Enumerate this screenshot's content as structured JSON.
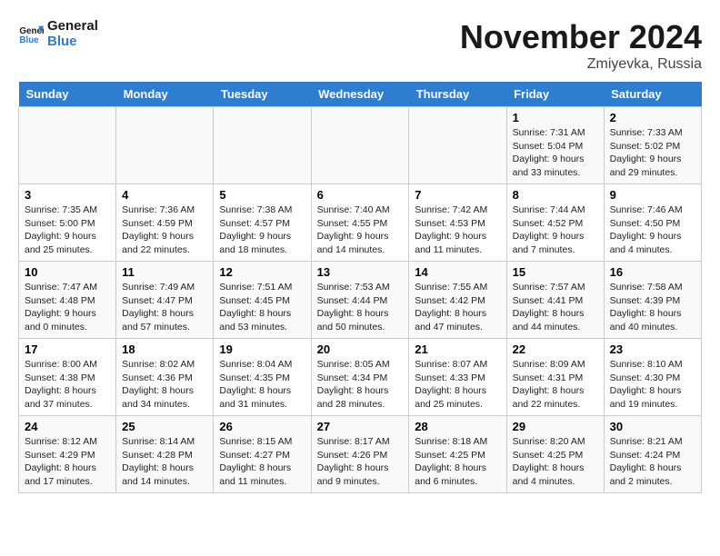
{
  "header": {
    "logo_line1": "General",
    "logo_line2": "Blue",
    "month": "November 2024",
    "location": "Zmiyevka, Russia"
  },
  "weekdays": [
    "Sunday",
    "Monday",
    "Tuesday",
    "Wednesday",
    "Thursday",
    "Friday",
    "Saturday"
  ],
  "weeks": [
    [
      {
        "day": "",
        "info": ""
      },
      {
        "day": "",
        "info": ""
      },
      {
        "day": "",
        "info": ""
      },
      {
        "day": "",
        "info": ""
      },
      {
        "day": "",
        "info": ""
      },
      {
        "day": "1",
        "info": "Sunrise: 7:31 AM\nSunset: 5:04 PM\nDaylight: 9 hours and 33 minutes."
      },
      {
        "day": "2",
        "info": "Sunrise: 7:33 AM\nSunset: 5:02 PM\nDaylight: 9 hours and 29 minutes."
      }
    ],
    [
      {
        "day": "3",
        "info": "Sunrise: 7:35 AM\nSunset: 5:00 PM\nDaylight: 9 hours and 25 minutes."
      },
      {
        "day": "4",
        "info": "Sunrise: 7:36 AM\nSunset: 4:59 PM\nDaylight: 9 hours and 22 minutes."
      },
      {
        "day": "5",
        "info": "Sunrise: 7:38 AM\nSunset: 4:57 PM\nDaylight: 9 hours and 18 minutes."
      },
      {
        "day": "6",
        "info": "Sunrise: 7:40 AM\nSunset: 4:55 PM\nDaylight: 9 hours and 14 minutes."
      },
      {
        "day": "7",
        "info": "Sunrise: 7:42 AM\nSunset: 4:53 PM\nDaylight: 9 hours and 11 minutes."
      },
      {
        "day": "8",
        "info": "Sunrise: 7:44 AM\nSunset: 4:52 PM\nDaylight: 9 hours and 7 minutes."
      },
      {
        "day": "9",
        "info": "Sunrise: 7:46 AM\nSunset: 4:50 PM\nDaylight: 9 hours and 4 minutes."
      }
    ],
    [
      {
        "day": "10",
        "info": "Sunrise: 7:47 AM\nSunset: 4:48 PM\nDaylight: 9 hours and 0 minutes."
      },
      {
        "day": "11",
        "info": "Sunrise: 7:49 AM\nSunset: 4:47 PM\nDaylight: 8 hours and 57 minutes."
      },
      {
        "day": "12",
        "info": "Sunrise: 7:51 AM\nSunset: 4:45 PM\nDaylight: 8 hours and 53 minutes."
      },
      {
        "day": "13",
        "info": "Sunrise: 7:53 AM\nSunset: 4:44 PM\nDaylight: 8 hours and 50 minutes."
      },
      {
        "day": "14",
        "info": "Sunrise: 7:55 AM\nSunset: 4:42 PM\nDaylight: 8 hours and 47 minutes."
      },
      {
        "day": "15",
        "info": "Sunrise: 7:57 AM\nSunset: 4:41 PM\nDaylight: 8 hours and 44 minutes."
      },
      {
        "day": "16",
        "info": "Sunrise: 7:58 AM\nSunset: 4:39 PM\nDaylight: 8 hours and 40 minutes."
      }
    ],
    [
      {
        "day": "17",
        "info": "Sunrise: 8:00 AM\nSunset: 4:38 PM\nDaylight: 8 hours and 37 minutes."
      },
      {
        "day": "18",
        "info": "Sunrise: 8:02 AM\nSunset: 4:36 PM\nDaylight: 8 hours and 34 minutes."
      },
      {
        "day": "19",
        "info": "Sunrise: 8:04 AM\nSunset: 4:35 PM\nDaylight: 8 hours and 31 minutes."
      },
      {
        "day": "20",
        "info": "Sunrise: 8:05 AM\nSunset: 4:34 PM\nDaylight: 8 hours and 28 minutes."
      },
      {
        "day": "21",
        "info": "Sunrise: 8:07 AM\nSunset: 4:33 PM\nDaylight: 8 hours and 25 minutes."
      },
      {
        "day": "22",
        "info": "Sunrise: 8:09 AM\nSunset: 4:31 PM\nDaylight: 8 hours and 22 minutes."
      },
      {
        "day": "23",
        "info": "Sunrise: 8:10 AM\nSunset: 4:30 PM\nDaylight: 8 hours and 19 minutes."
      }
    ],
    [
      {
        "day": "24",
        "info": "Sunrise: 8:12 AM\nSunset: 4:29 PM\nDaylight: 8 hours and 17 minutes."
      },
      {
        "day": "25",
        "info": "Sunrise: 8:14 AM\nSunset: 4:28 PM\nDaylight: 8 hours and 14 minutes."
      },
      {
        "day": "26",
        "info": "Sunrise: 8:15 AM\nSunset: 4:27 PM\nDaylight: 8 hours and 11 minutes."
      },
      {
        "day": "27",
        "info": "Sunrise: 8:17 AM\nSunset: 4:26 PM\nDaylight: 8 hours and 9 minutes."
      },
      {
        "day": "28",
        "info": "Sunrise: 8:18 AM\nSunset: 4:25 PM\nDaylight: 8 hours and 6 minutes."
      },
      {
        "day": "29",
        "info": "Sunrise: 8:20 AM\nSunset: 4:25 PM\nDaylight: 8 hours and 4 minutes."
      },
      {
        "day": "30",
        "info": "Sunrise: 8:21 AM\nSunset: 4:24 PM\nDaylight: 8 hours and 2 minutes."
      }
    ]
  ]
}
